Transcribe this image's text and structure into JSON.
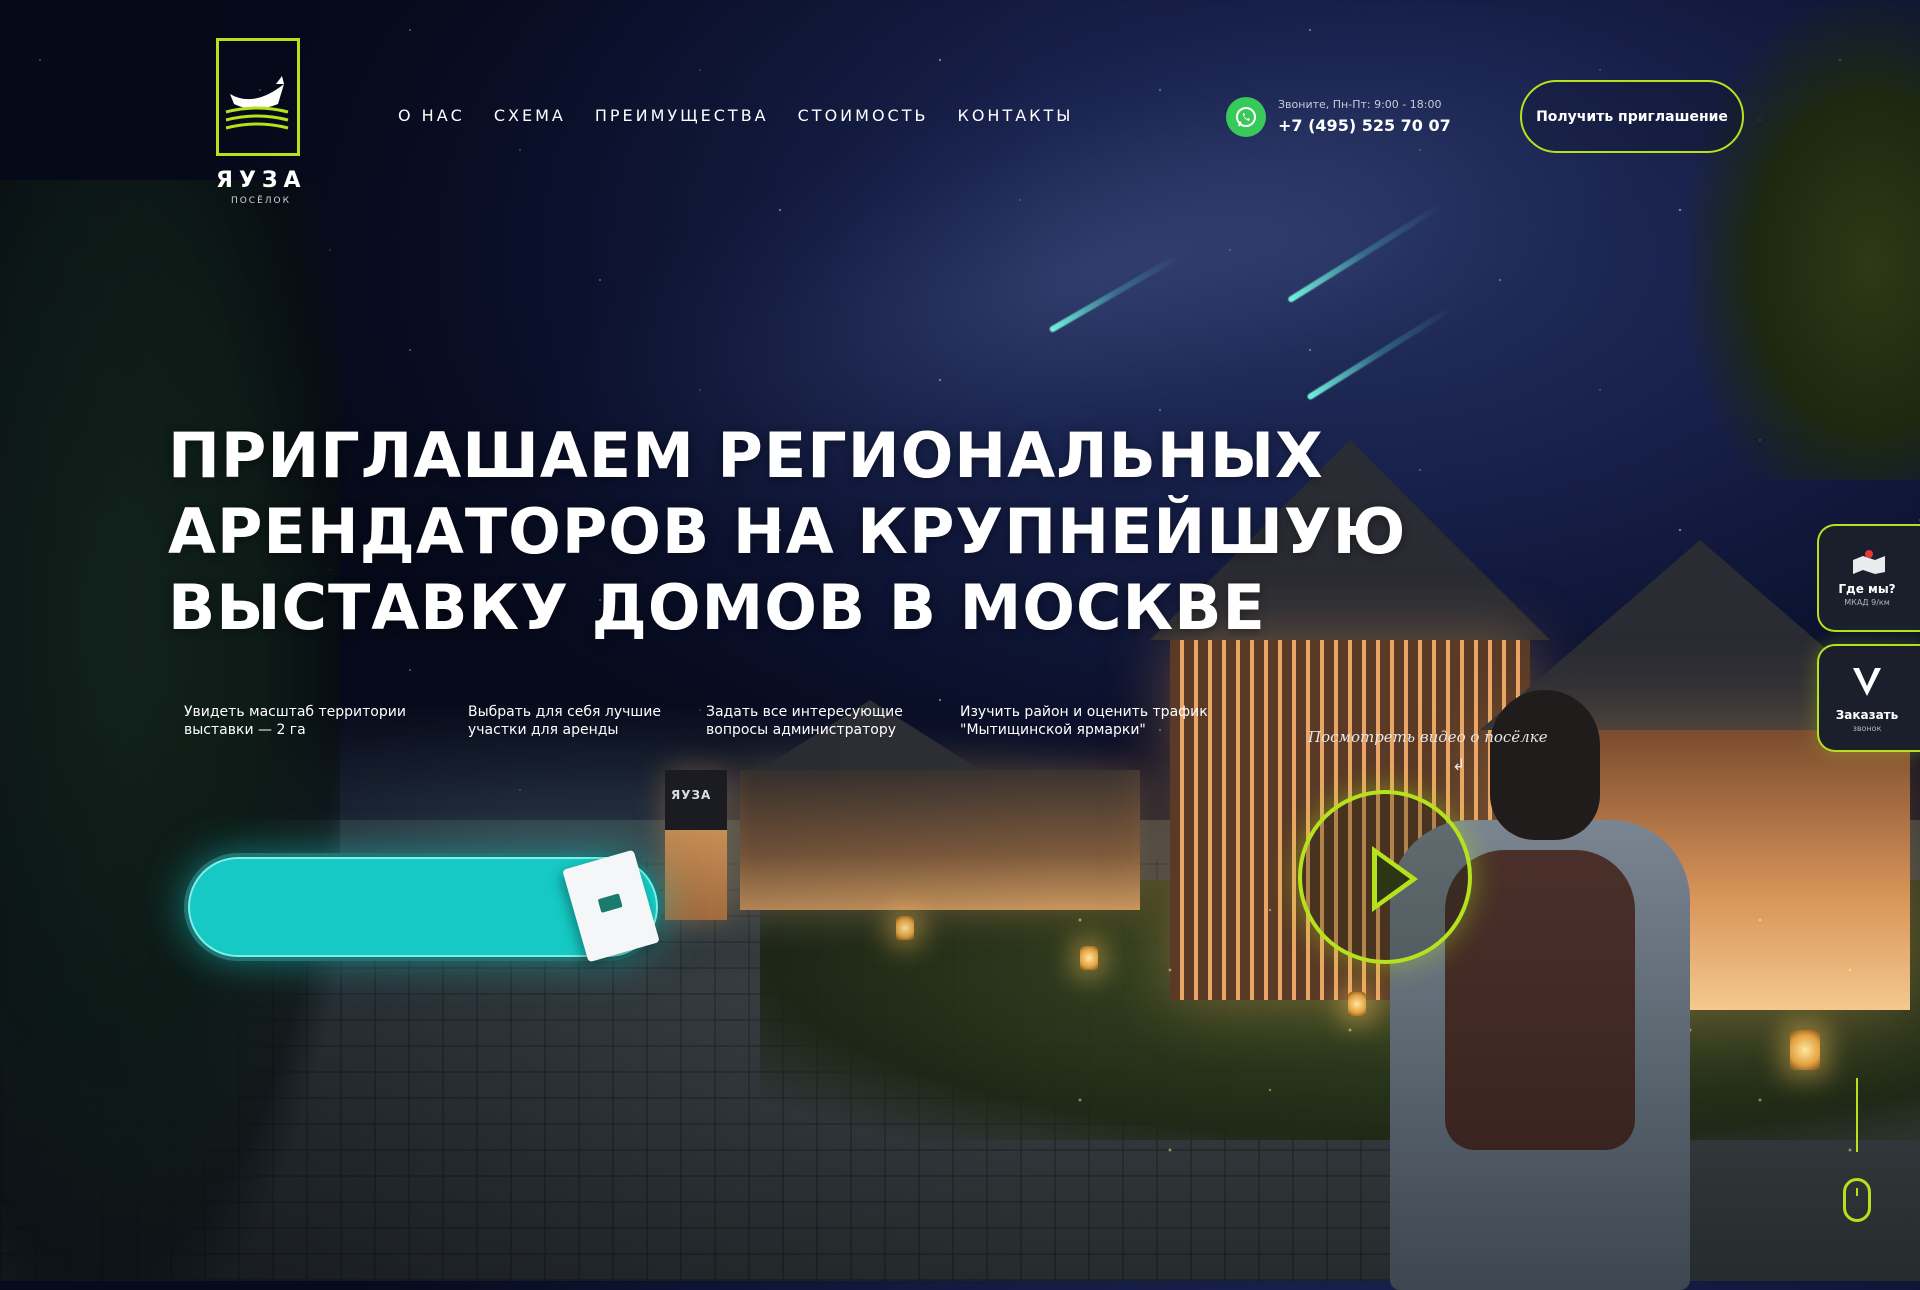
{
  "brand": {
    "name": "ЯУЗА",
    "subtitle": "ПОСЁЛОК"
  },
  "nav": {
    "items": [
      {
        "label": "О НАС"
      },
      {
        "label": "СХЕМА"
      },
      {
        "label": "ПРЕИМУЩЕСТВА"
      },
      {
        "label": "СТОИМОСТЬ"
      },
      {
        "label": "КОНТАКТЫ"
      }
    ]
  },
  "contact": {
    "hours": "Звоните, Пн-Пт: 9:00 - 18:00",
    "phone": "+7 (495) 525 70 07",
    "whatsapp_icon": "whatsapp-icon"
  },
  "header": {
    "invite_button": "Получить приглашение"
  },
  "hero": {
    "title_lines": [
      "ПРИГЛАШАЕМ  РЕГИОНАЛЬНЫХ",
      "АРЕНДАТОРОВ  НА КРУПНЕЙШУЮ",
      "ВЫСТАВКУ ДОМОВ В МОСКВЕ"
    ],
    "features": [
      {
        "line1": "Увидеть масштаб территории",
        "line2": "выставки — 2 га"
      },
      {
        "line1": "Выбрать для себя лучшие",
        "line2": "участки для аренды"
      },
      {
        "line1": "Задать все интересующие",
        "line2": "вопросы администратору"
      },
      {
        "line1": "Изучить район и оценить трафик",
        "line2": "\"Мытищинской ярмарки\""
      }
    ],
    "video_link": "Посмотреть видео о посёлке",
    "video_arrow": "↲",
    "sign_text": "ЯУЗА"
  },
  "side": {
    "where": {
      "title": "Где мы?",
      "subtitle": "МКАД 9/км"
    },
    "order": {
      "title": "Заказать",
      "subtitle": "звонок"
    }
  },
  "colors": {
    "accent": "#b6e21d",
    "cta": "#16c9c4",
    "whatsapp": "#37c95a"
  }
}
